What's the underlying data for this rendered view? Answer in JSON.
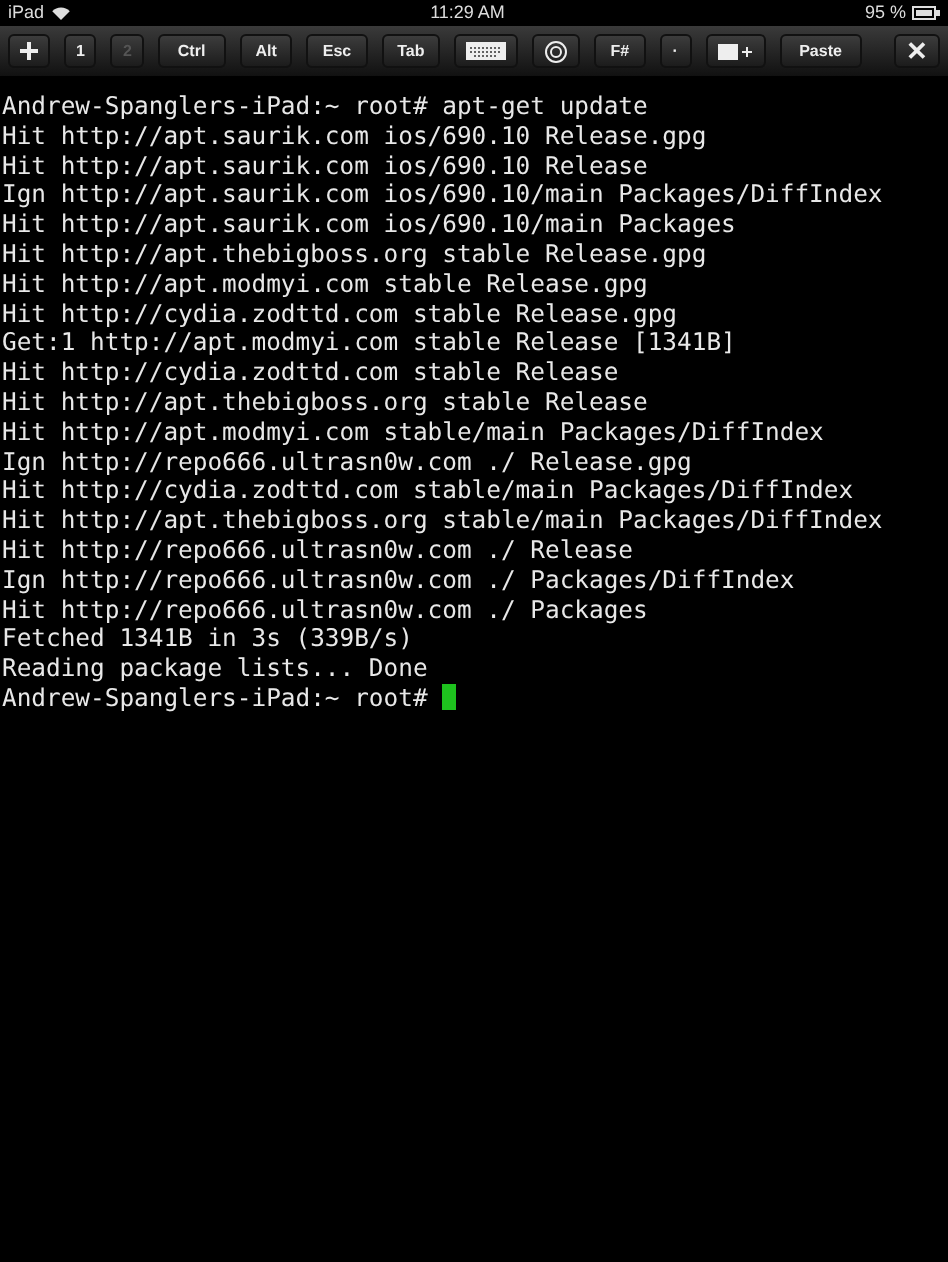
{
  "status_bar": {
    "device": "iPad",
    "time": "11:29 AM",
    "battery": "95 %"
  },
  "toolbar": {
    "keys": [
      {
        "kind": "icon",
        "disabled": false
      },
      {
        "kind": "text",
        "label": "1",
        "disabled": false
      },
      {
        "kind": "text",
        "label": "2",
        "disabled": true
      },
      {
        "kind": "text",
        "label": "Ctrl",
        "disabled": false
      },
      {
        "kind": "text",
        "label": "Alt",
        "disabled": false
      },
      {
        "kind": "text",
        "label": "Esc",
        "disabled": false
      },
      {
        "kind": "text",
        "label": "Tab",
        "disabled": false
      },
      {
        "kind": "icon",
        "disabled": false
      },
      {
        "kind": "icon",
        "disabled": false
      },
      {
        "kind": "text",
        "label": "F#",
        "disabled": false
      },
      {
        "kind": "text",
        "label": "·",
        "disabled": false
      },
      {
        "kind": "icon",
        "disabled": false
      },
      {
        "kind": "text",
        "label": "Paste",
        "disabled": false
      }
    ],
    "close": "✕"
  },
  "terminal": {
    "lines": [
      "Andrew-Spanglers-iPad:~ root# apt-get update",
      "Hit http://apt.saurik.com ios/690.10 Release.gpg",
      "Hit http://apt.saurik.com ios/690.10 Release",
      "Ign http://apt.saurik.com ios/690.10/main Packages/DiffIndex",
      "Hit http://apt.saurik.com ios/690.10/main Packages",
      "Hit http://apt.thebigboss.org stable Release.gpg",
      "Hit http://apt.modmyi.com stable Release.gpg",
      "Hit http://cydia.zodttd.com stable Release.gpg",
      "Get:1 http://apt.modmyi.com stable Release [1341B]",
      "Hit http://cydia.zodttd.com stable Release",
      "Hit http://apt.thebigboss.org stable Release",
      "Hit http://apt.modmyi.com stable/main Packages/DiffIndex",
      "Ign http://repo666.ultrasn0w.com ./ Release.gpg",
      "Hit http://cydia.zodttd.com stable/main Packages/DiffIndex",
      "Hit http://apt.thebigboss.org stable/main Packages/DiffIndex",
      "Hit http://repo666.ultrasn0w.com ./ Release",
      "Ign http://repo666.ultrasn0w.com ./ Packages/DiffIndex",
      "Hit http://repo666.ultrasn0w.com ./ Packages",
      "Fetched 1341B in 3s (339B/s)",
      "Reading package lists... Done"
    ],
    "prompt": "Andrew-Spanglers-iPad:~ root#"
  }
}
